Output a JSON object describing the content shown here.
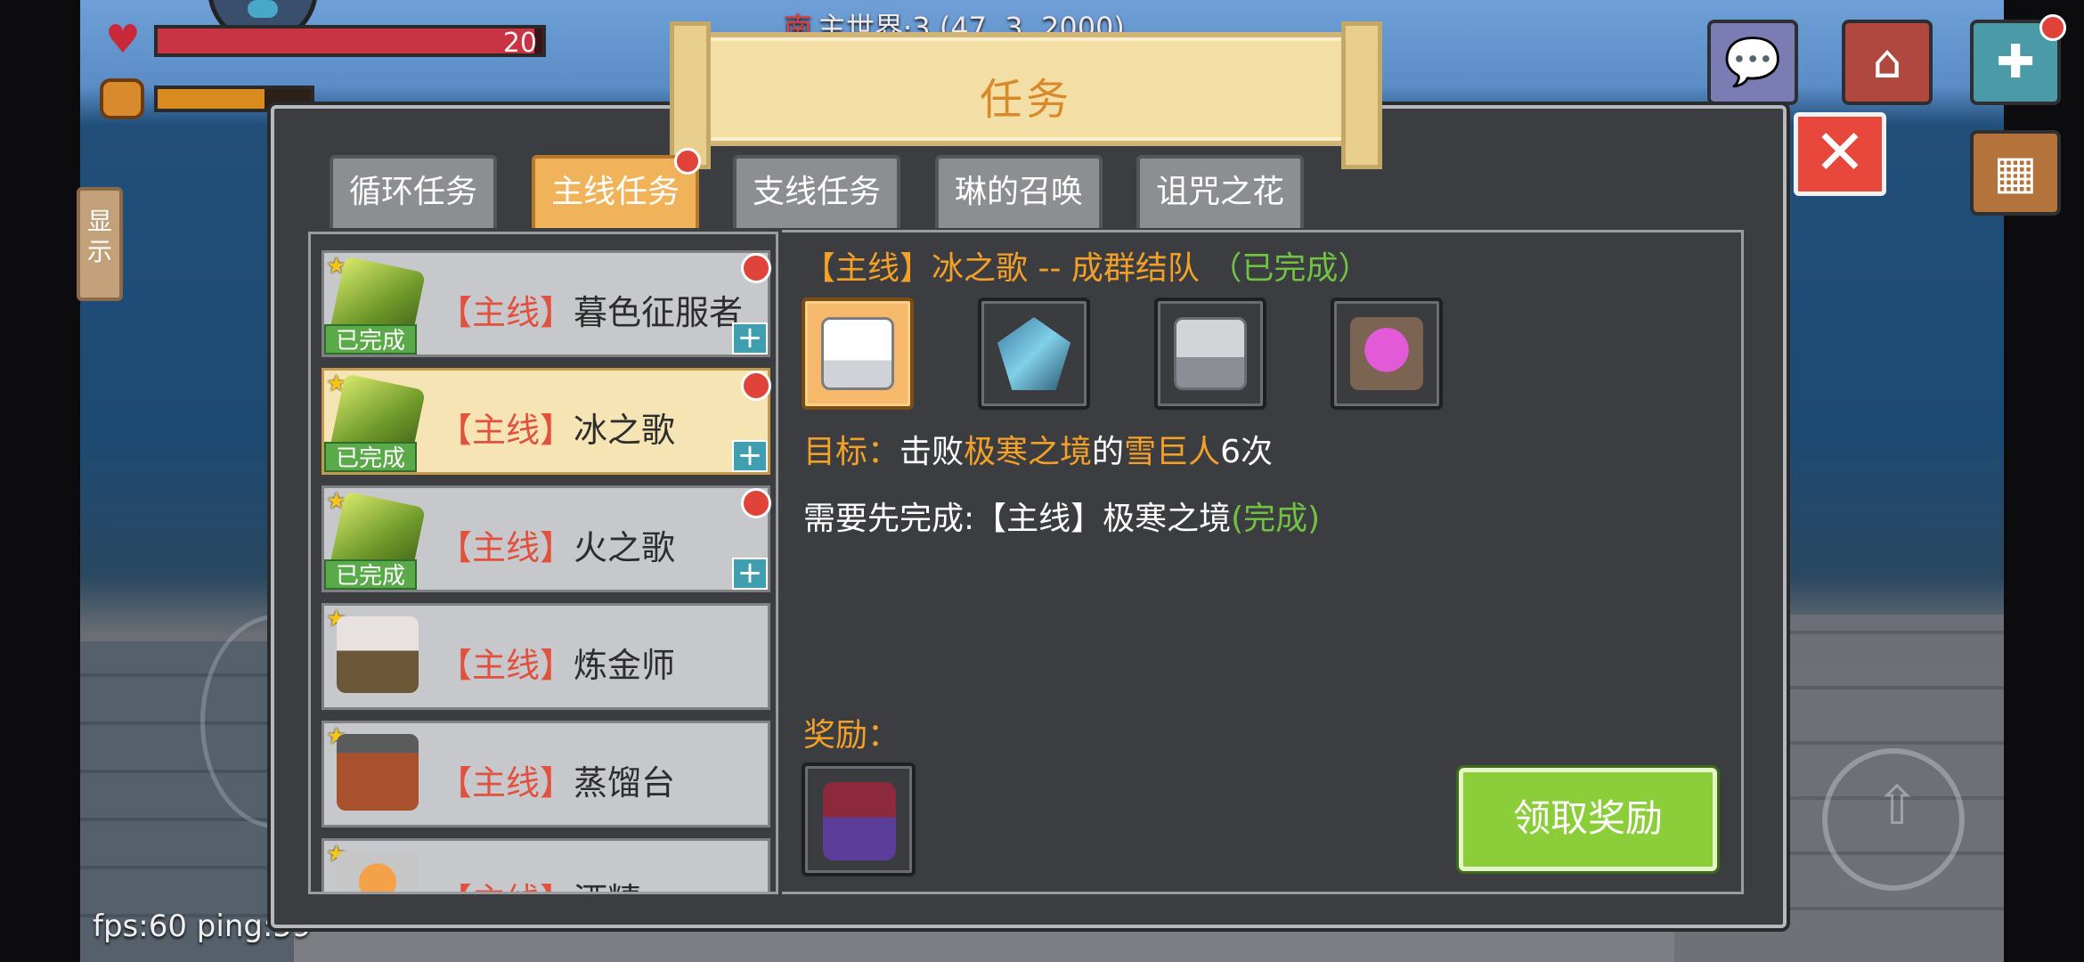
{
  "hud": {
    "health_value": "20",
    "health_fraction": 0.98,
    "hunger_fraction": 0.7,
    "direction": "南",
    "location": "主世界·3 (47, 3, 2000)",
    "side_tab_label": "显示",
    "fps": "fps:60 ping:59"
  },
  "dialog": {
    "title": "任务",
    "tabs": [
      {
        "label": "循环任务",
        "active": false,
        "badge": false
      },
      {
        "label": "主线任务",
        "active": true,
        "badge": true
      },
      {
        "label": "支线任务",
        "active": false,
        "badge": false
      },
      {
        "label": "琳的召唤",
        "active": false,
        "badge": false
      },
      {
        "label": "诅咒之花",
        "active": false,
        "badge": false
      }
    ],
    "quests": [
      {
        "tag": "【主线】",
        "name": "暮色征服者",
        "status": "已完成",
        "selected": false,
        "icon": "gem-icon"
      },
      {
        "tag": "【主线】",
        "name": "冰之歌",
        "status": "已完成",
        "selected": true,
        "icon": "gem-icon"
      },
      {
        "tag": "【主线】",
        "name": "火之歌",
        "status": "已完成",
        "selected": false,
        "icon": "gem-icon"
      },
      {
        "tag": "【主线】",
        "name": "炼金师",
        "status": "",
        "selected": false,
        "icon": "alchemy-table-icon"
      },
      {
        "tag": "【主线】",
        "name": "蒸馏台",
        "status": "",
        "selected": false,
        "icon": "distiller-icon"
      },
      {
        "tag": "【主线】",
        "name": "酒精",
        "status": "",
        "selected": false,
        "icon": "spirit-lamp-icon"
      }
    ],
    "detail": {
      "title_prefix": "【主线】冰之歌",
      "title_sep": "--",
      "title_sub": "成群结队",
      "title_status": "（已完成）",
      "target_items": [
        "snowman-icon",
        "ice-shard-icon",
        "ice-golem-icon",
        "crystal-egg-icon"
      ],
      "goal_label": "目标：",
      "goal_text1": "击败",
      "goal_place": "极寒之境",
      "goal_text2": "的",
      "goal_mob": "雪巨人",
      "goal_count": "6次",
      "req_text": "需要先完成:【主线】极寒之境",
      "req_status": "(完成)",
      "reward_label": "奖励：",
      "reward_item": "gift-bag-icon",
      "claim_label": "领取奖励"
    }
  },
  "colors": {
    "accent_orange": "#f3a028",
    "done_green": "#71c242",
    "tag_red": "#e2503e",
    "claim_green": "#8ccd3a"
  }
}
